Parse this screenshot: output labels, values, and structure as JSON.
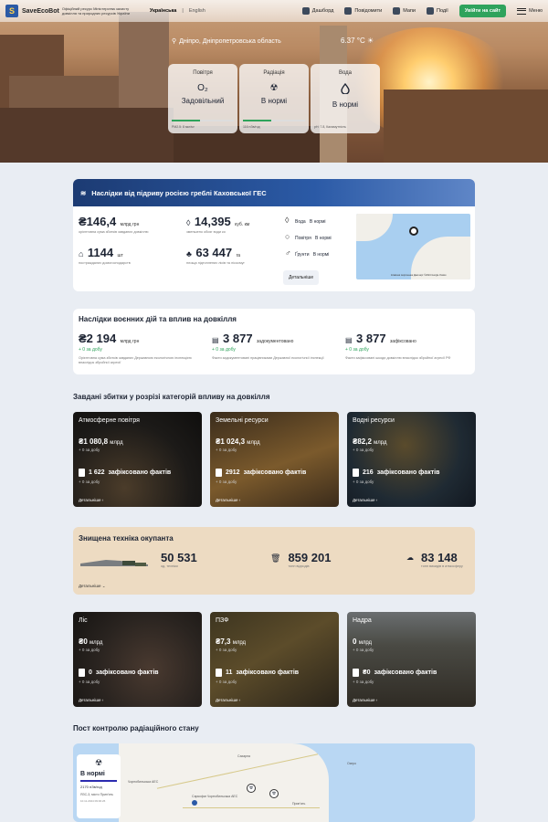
{
  "header": {
    "logo": "SaveEcoBot",
    "ministry": "Офіційний ресурс Міністерства захисту довкілля та природних ресурсів України",
    "lang_active": "Українська",
    "lang_other": "English",
    "nav": [
      "Дашборд",
      "Повідомити",
      "Мапи",
      "Події"
    ],
    "login": "Увійти на сайт",
    "menu": "Меню"
  },
  "hero": {
    "location": "Дніпро, Дніпропетровська область",
    "temperature": "6.37 °C",
    "cards": [
      {
        "title": "Повітря",
        "icon": "O₂",
        "value": "Задовільний",
        "note": "PM2.5: 8 мкг/м³"
      },
      {
        "title": "Радіація",
        "icon": "☢",
        "value": "В нормі",
        "note": "116 нЗв/год"
      },
      {
        "title": "Вода",
        "icon": "💧",
        "value": "В нормі",
        "note": "рН: 7.8, Каламутність"
      }
    ]
  },
  "kakhovka": {
    "title": "Наслідки від підриву росією греблі Каховської ГЕС",
    "stats": [
      {
        "value": "₴146,4",
        "unit": "млрд грн",
        "desc": "орієнтовна сума збитків завданих довкіллю"
      },
      {
        "value": "14,395",
        "unit": "куб. км",
        "desc": "зменшено обсяг води ко"
      },
      {
        "value": "1144",
        "unit": "шт",
        "desc": "постраждалих домогосподарств"
      },
      {
        "value": "63 447",
        "unit": "га",
        "desc": "площа підтоплених лісів та лісосмуг"
      }
    ],
    "status": [
      {
        "label": "Вода",
        "value": "В нормі"
      },
      {
        "label": "Повітря",
        "value": "В нормі"
      },
      {
        "label": "Ґрунти",
        "value": "В нормі"
      }
    ],
    "details": "Детальніше",
    "map_attr": "Клавішні скорочення   Дані карт ©2024 Google   Умови"
  },
  "war": {
    "title": "Наслідки воєнних дій та вплив на довкілля",
    "items": [
      {
        "value": "₴2 194",
        "unit": "млрд грн",
        "delta": "+ 0 за добу",
        "desc": "Орієнтовна сума збитків завданих Державною екологічною інспекцією внаслідок збройної агресії"
      },
      {
        "value": "3 877",
        "unit": "задокументовано",
        "delta": "+ 0 за добу",
        "desc": "Факти задокументовані працівниками Державної екологічної інспекції"
      },
      {
        "value": "3 877",
        "unit": "зафіксовано",
        "delta": "+ 0 за добу",
        "desc": "Факти зафіксовані шкоди довкіллю внаслідок збройної агресії РФ"
      }
    ]
  },
  "damages": {
    "title": "Завдані збитки у розрізі категорій впливу на довкілля",
    "delta": "+ 0 за добу",
    "details": "Детальніше",
    "tiles": [
      {
        "name": "Атмосферне повітря",
        "value": "₴1 080,8",
        "unit": "млрд",
        "facts": "1 622",
        "facts_label": "зафіксовано фактів"
      },
      {
        "name": "Земельні ресурси",
        "value": "₴1 024,3",
        "unit": "млрд",
        "facts": "2912",
        "facts_label": "зафіксовано фактів"
      },
      {
        "name": "Водні ресурси",
        "value": "₴82,2",
        "unit": "млрд",
        "facts": "216",
        "facts_label": "зафіксовано фактів"
      },
      {
        "name": "Ліс",
        "value": "₴0",
        "unit": "млрд",
        "facts": "0",
        "facts_label": "зафіксовано фактів"
      },
      {
        "name": "ПЗФ",
        "value": "₴7,3",
        "unit": "млрд",
        "facts": "11",
        "facts_label": "зафіксовано фактів"
      },
      {
        "name": "Надра",
        "value": "0",
        "unit": "млрд",
        "facts": "₴0",
        "facts_label": "зафіксовано фактів"
      }
    ]
  },
  "tech": {
    "title": "Знищена техніка окупанта",
    "items": [
      {
        "value": "50 531",
        "label": "од. техніки"
      },
      {
        "value": "859 201",
        "label": "тонн відходів"
      },
      {
        "value": "83 148",
        "label": "тонн викидів в атмосферу"
      }
    ],
    "details": "Детальніше"
  },
  "radiation": {
    "title": "Пост контролю радіаційного стану",
    "status": "В нормі",
    "value": "2170 нЗв/год",
    "station": "ЯЗС-3, місто Прип'ять",
    "date": "10.11.2024 09:00:26",
    "map_labels": [
      "Сахарна",
      "Прип'ять",
      "Озеро",
      "Чорнобильська АЕС",
      "Саркофаг Чорнобильська АЕС"
    ]
  }
}
